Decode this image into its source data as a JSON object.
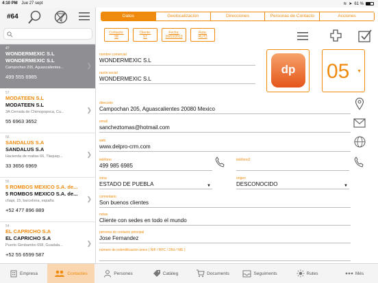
{
  "status": {
    "time": "4:10 PM",
    "date": "Jue 27 sept",
    "battery": "61 %",
    "battery_level": 0.61
  },
  "list_header": {
    "count": "#64"
  },
  "search": {
    "placeholder": ""
  },
  "contacts": [
    {
      "num": "4?",
      "name1": "WONDERMEXIC S.L",
      "name2": "WONDERMEXIC S.L",
      "addr": "Campochan 205, Aguascalientes...",
      "phone": "499 555 6985",
      "selected": true
    },
    {
      "num": "57",
      "name1": "MODATEEN S.L",
      "name2": "MODATEEN S.L",
      "addr": "3A Cerrada de Chimopopoca, Cu...",
      "phone": "55 6963 3652",
      "selected": false
    },
    {
      "num": "56",
      "name1": "SANDALUS S.A",
      "name2": "SANDALUS S.A",
      "addr": "Hacienda de maitas 66, Tlaquep...",
      "phone": "33 3656 6969",
      "selected": false
    },
    {
      "num": "55",
      "name1": "5 ROMBOS MEXICO S.A. de...",
      "name2": "5 ROMBOS MEXICO S.A. de...",
      "addr": "chapi, 15, barcelona, españa",
      "phone": "+52 477 896 889",
      "selected": false
    },
    {
      "num": "54",
      "name1": "EL CAPRICHO S.A",
      "name2": "EL CAPRICHO S.A",
      "addr": "Puerto Gimbambo 658, Guadala...",
      "phone": "+52 55 6599 587",
      "selected": false
    }
  ],
  "tabs": [
    {
      "label": "Datos",
      "active": true
    },
    {
      "label": "Geolocalización",
      "active": false
    },
    {
      "label": "Direcciones",
      "active": false
    },
    {
      "label": "Personas de Contacto",
      "active": false
    },
    {
      "label": "Acciones",
      "active": false
    }
  ],
  "minis": [
    {
      "label": "Contacto:",
      "value": "58"
    },
    {
      "label": "Cliente:",
      "value": "57"
    },
    {
      "label": "Fecha:",
      "value": "26/03/2013"
    },
    {
      "label": "Ruta:",
      "value": "RUT3"
    }
  ],
  "form": {
    "nombre_comercial": {
      "label": "nombre comercial",
      "value": "WONDERMEXIC S.L"
    },
    "razon_social": {
      "label": "razón social",
      "value": "WONDERMEXIC S.L"
    },
    "direccion": {
      "label": "dirección",
      "value": "Campochan 205, Aguascalientes 20080 Mexico"
    },
    "email": {
      "label": "email",
      "value": "sancheztomas@hotmail.com"
    },
    "web": {
      "label": "web",
      "value": "www.delpro-crm.com"
    },
    "telefono": {
      "label": "teléfono",
      "value": "499 985 6985"
    },
    "telefono2": {
      "label": "teléfono2",
      "value": ""
    },
    "zona": {
      "label": "zona",
      "value": "ESTADO DE PUEBLA"
    },
    "origen": {
      "label": "origen",
      "value": "DESCONOCIDO"
    },
    "comentario": {
      "label": "comentario",
      "value": "Son buenos clientes"
    },
    "notas": {
      "label": "notas",
      "value": "Cliente con sedes en todo el mundo"
    },
    "persona_contacto": {
      "label": "persona de contacto principal",
      "value": "Jose Fernandez"
    },
    "nif": {
      "label": "número de indentificación único ( NIF / RFC / DNI / NIE )",
      "value": ""
    }
  },
  "logo_text": "dp",
  "zone_number": "05",
  "bottom_tabs": [
    {
      "label": "Empresa",
      "icon": "building-icon",
      "active": false
    },
    {
      "label": "Contactes",
      "icon": "people-icon",
      "active": true
    },
    {
      "label": "Persones",
      "icon": "person-icon",
      "active": false
    },
    {
      "label": "Catàleg",
      "icon": "tag-icon",
      "active": false
    },
    {
      "label": "Documents",
      "icon": "cart-icon",
      "active": false
    },
    {
      "label": "Seguiments",
      "icon": "inbox-icon",
      "active": false
    },
    {
      "label": "Rutes",
      "icon": "sun-icon",
      "active": false
    },
    {
      "label": "Més",
      "icon": "more-icon",
      "active": false
    }
  ],
  "colors": {
    "accent": "#f08a0c",
    "selected_row": "#8e8e93",
    "active_tab_bg": "#fad6b0"
  }
}
